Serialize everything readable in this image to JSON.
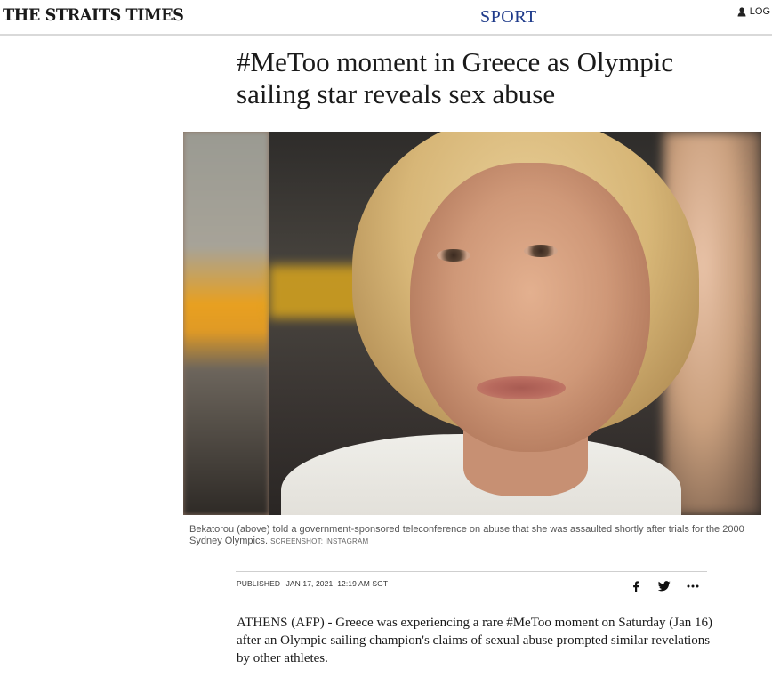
{
  "header": {
    "logo": "THE STRAITS TIMES",
    "section": "SPORT",
    "login_label": "LOG",
    "icons": {
      "login": "user-icon"
    }
  },
  "article": {
    "headline": "#MeToo moment in Greece as Olympic sailing star reveals sex abuse",
    "photo": {
      "caption": "Bekatorou (above) told a government-sponsored teleconference on abuse that she was assaulted shortly after trials for the 2000 Sydney Olympics.",
      "credit": "SCREENSHOT: INSTAGRAM"
    },
    "published_label": "PUBLISHED",
    "published_date": "JAN 17, 2021, 12:19 AM SGT",
    "share": {
      "icons": [
        "facebook-icon",
        "twitter-icon",
        "more-icon"
      ]
    },
    "body": "ATHENS (AFP) - Greece was experiencing a rare #MeToo moment on Saturday (Jan 16) after an Olympic sailing champion's claims of sexual abuse prompted similar revelations by other athletes."
  },
  "colors": {
    "section_link": "#1e3a8a",
    "text": "#1a1a1a",
    "rule": "#d9d9d9"
  }
}
